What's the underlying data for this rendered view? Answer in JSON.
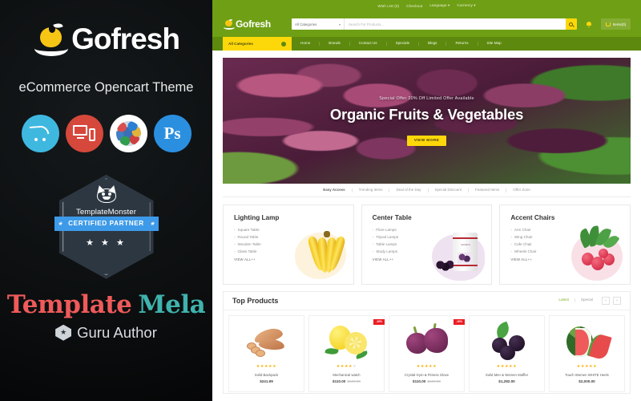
{
  "promo": {
    "brand_name": "Gofresh",
    "subtitle": "eCommerce Opencart Theme",
    "feature_icons": [
      {
        "name": "opencart-icon",
        "label": "OpenCart"
      },
      {
        "name": "responsive-devices-icon",
        "label": "Responsive"
      },
      {
        "name": "multilanguage-globe-icon",
        "label": "Multi Language"
      },
      {
        "name": "photoshop-icon",
        "label": "Ps"
      }
    ],
    "badge": {
      "monster_name": "TemplateMonster",
      "ribbon": "CERTIFIED PARTNER",
      "stars": "★ ★ ★"
    },
    "author_logo": {
      "word1": "Template",
      "word2": "Mela"
    },
    "author_tagline": "Guru Author"
  },
  "site": {
    "topbar_links": [
      "Wish List (0)",
      "Checkout",
      "Language",
      "Currency"
    ],
    "header": {
      "logo_text": "Gofresh",
      "category_select": "All Categories",
      "search_placeholder": "Search For Products...",
      "search_button": "search-icon",
      "cart_label": "Items(0)"
    },
    "nav": {
      "all_categories": "All Categories",
      "links": [
        "Home",
        "Brands",
        "Contact Us",
        "Specials",
        "Blogs",
        "Returns",
        "Site Map"
      ]
    },
    "hero": {
      "kicker": "Special Offer 20% Off Limited Offer Available",
      "title": "Organic Fruits & Vegetables",
      "button": "VIEW MORE"
    },
    "quick_links": [
      "Easy Access",
      "Trending Items",
      "Deal of the Day",
      "Special Discount",
      "Featured Items",
      "Offer Zone"
    ],
    "category_boxes": [
      {
        "title": "Lighting Lamp",
        "items": [
          "Square Table",
          "Round Table",
          "Wooden Table",
          "Glass Table"
        ],
        "view_all": "VIEW ALL++",
        "image": "bananas"
      },
      {
        "title": "Center Table",
        "items": [
          "Flore Lamps",
          "Tripod Lamps",
          "Table Lamps",
          "Study Lamps"
        ],
        "view_all": "VIEW ALL++",
        "image": "berry-jar"
      },
      {
        "title": "Accent Chairs",
        "items": [
          "Arm Chair",
          "Wing Chair",
          "Cafe Chair",
          "Wheels Chair"
        ],
        "view_all": "VIEW ALL++",
        "image": "radishes"
      }
    ],
    "top_products": {
      "heading": "Top Products",
      "tabs": [
        {
          "label": "Latest",
          "active": true
        },
        {
          "label": "Special",
          "active": false
        }
      ],
      "prev_arrow": "‹",
      "next_arrow": "›",
      "products": [
        {
          "name": "Solid Backpack",
          "price": "$241.99",
          "old_price": "",
          "rating": 5,
          "badge": "",
          "image": "sweet-potato"
        },
        {
          "name": "Mechanical watch",
          "price": "$110.00",
          "old_price": "$120.00",
          "rating": 4,
          "badge": "-10%",
          "image": "lemon"
        },
        {
          "name": "Crystal Gym & Fitness Glove",
          "price": "$110.00",
          "old_price": "$120.00",
          "rating": 5,
          "badge": "-10%",
          "image": "red-onion"
        },
        {
          "name": "Solid Men & Women Muffler",
          "price": "$1,282.00",
          "old_price": "",
          "rating": 5,
          "badge": "",
          "image": "blackberry"
        },
        {
          "name": "Touch Women WHITE Heels",
          "price": "$2,000.00",
          "old_price": "",
          "rating": 5,
          "badge": "",
          "image": "watermelon"
        }
      ]
    }
  },
  "colors": {
    "header_green": "#6f9f14",
    "nav_green": "#5d8a0e",
    "accent_yellow": "#fcd80a",
    "sale_red": "#ec1c24",
    "partner_blue": "#3d9ae8",
    "template_red": "#ef5a5a",
    "mela_teal": "#3fb3ad",
    "panel_black": "#0d0f10"
  }
}
